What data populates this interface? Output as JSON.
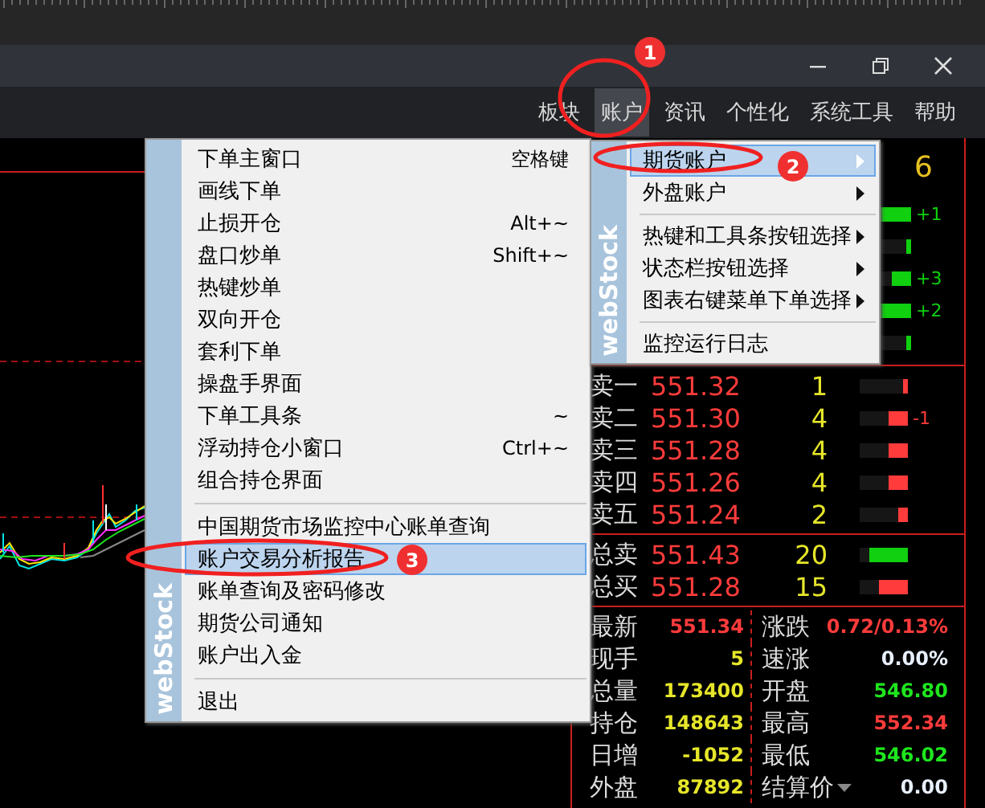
{
  "menubar": [
    {
      "label": "板块",
      "selected": false
    },
    {
      "label": "账户",
      "selected": true
    },
    {
      "label": "资讯",
      "selected": false
    },
    {
      "label": "个性化",
      "selected": false
    },
    {
      "label": "系统工具",
      "selected": false
    },
    {
      "label": "帮助",
      "selected": false
    }
  ],
  "account_menu": {
    "brand_text": "webStock",
    "items": [
      {
        "kind": "item",
        "label": "下单主窗口",
        "shortcut": "空格键",
        "selected": false
      },
      {
        "kind": "item",
        "label": "画线下单",
        "selected": false
      },
      {
        "kind": "item",
        "label": "止损开仓",
        "shortcut": "Alt+~",
        "selected": false
      },
      {
        "kind": "item",
        "label": "盘口炒单",
        "shortcut": "Shift+~",
        "selected": false
      },
      {
        "kind": "item",
        "label": "热键炒单",
        "selected": false
      },
      {
        "kind": "item",
        "label": "双向开仓",
        "selected": false
      },
      {
        "kind": "item",
        "label": "套利下单",
        "selected": false
      },
      {
        "kind": "item",
        "label": "操盘手界面",
        "selected": false
      },
      {
        "kind": "item",
        "label": "下单工具条",
        "shortcut": "~",
        "selected": false
      },
      {
        "kind": "item",
        "label": "浮动持仓小窗口",
        "shortcut": "Ctrl+~",
        "selected": false
      },
      {
        "kind": "item",
        "label": "组合持仓界面",
        "selected": false
      },
      {
        "kind": "separator"
      },
      {
        "kind": "item",
        "label": "中国期货市场监控中心账单查询",
        "selected": false
      },
      {
        "kind": "item",
        "label": "账户交易分析报告",
        "selected": true
      },
      {
        "kind": "item",
        "label": "账单查询及密码修改",
        "selected": false
      },
      {
        "kind": "item",
        "label": "期货公司通知",
        "selected": false
      },
      {
        "kind": "item",
        "label": "账户出入金",
        "selected": false
      },
      {
        "kind": "separator"
      },
      {
        "kind": "item",
        "label": "退出",
        "selected": false
      }
    ]
  },
  "submenu": {
    "brand_text": "webStock",
    "items": [
      {
        "kind": "item",
        "label": "期货账户",
        "has_submenu": true,
        "selected": true
      },
      {
        "kind": "item",
        "label": "外盘账户",
        "has_submenu": true,
        "selected": false
      },
      {
        "kind": "separator"
      },
      {
        "kind": "item",
        "label": "热键和工具条按钮选择",
        "has_submenu": true,
        "selected": false
      },
      {
        "kind": "item",
        "label": "状态栏按钮选择",
        "has_submenu": true,
        "selected": false
      },
      {
        "kind": "item",
        "label": "图表右键菜单下单选择",
        "has_submenu": true,
        "selected": false
      },
      {
        "kind": "separator"
      },
      {
        "kind": "item",
        "label": "监控运行日志",
        "has_submenu": false,
        "selected": false
      }
    ]
  },
  "annotations": [
    {
      "label": "1"
    },
    {
      "label": "2"
    },
    {
      "label": "3"
    }
  ],
  "quote": {
    "partial_price": "6",
    "upper_bars": [
      {
        "level": 0.67,
        "change": "+1"
      },
      {
        "level": 0.1
      },
      {
        "level": 0.4,
        "change": "+3"
      },
      {
        "level": 0.67,
        "change": "+2"
      },
      {
        "level": 0.1
      }
    ],
    "order_rows": [
      {
        "label": "卖一",
        "price": "551.32",
        "volume": "1",
        "level": 0.1,
        "color": "#ff3b3b"
      },
      {
        "label": "卖二",
        "price": "551.30",
        "volume": "4",
        "level": 0.4,
        "color": "#ff3b3b",
        "change": "-1"
      },
      {
        "label": "卖三",
        "price": "551.28",
        "volume": "4",
        "level": 0.4,
        "color": "#ff3b3b"
      },
      {
        "label": "卖四",
        "price": "551.26",
        "volume": "4",
        "level": 0.4,
        "color": "#ff3b3b"
      },
      {
        "label": "卖五",
        "price": "551.24",
        "volume": "2",
        "level": 0.2,
        "color": "#ff3b3b"
      }
    ],
    "totals": [
      {
        "label": "总卖",
        "price": "551.43",
        "volume": "20",
        "level": 0.8,
        "color": "#10d010"
      },
      {
        "label": "总买",
        "price": "551.28",
        "volume": "15",
        "level": 0.6,
        "color": "#ff3b3b"
      }
    ],
    "stats": [
      {
        "label": "最新",
        "value": "551.34",
        "color": "#ff3b3b"
      },
      {
        "label": "涨跌",
        "value": "0.72/0.13%",
        "color": "#ff3b3b"
      },
      {
        "label": "现手",
        "value": "5",
        "color": "#e6e62a"
      },
      {
        "label": "速涨",
        "value": "0.00%",
        "color": "#e8f0ff"
      },
      {
        "label": "总量",
        "value": "173400",
        "color": "#e6e62a"
      },
      {
        "label": "开盘",
        "value": "546.80",
        "color": "#1ee61e"
      },
      {
        "label": "持仓",
        "value": "148643",
        "color": "#e6e62a"
      },
      {
        "label": "最高",
        "value": "552.34",
        "color": "#ff3b3b"
      },
      {
        "label": "日增",
        "value": "-1052",
        "color": "#e6e62a"
      },
      {
        "label": "最低",
        "value": "546.02",
        "color": "#1ee61e"
      },
      {
        "label": "外盘",
        "value": "87892",
        "color": "#e6e62a"
      },
      {
        "label": "结算价",
        "value": "0.00",
        "color": "#e8f0ff",
        "dropdown": true
      }
    ]
  }
}
